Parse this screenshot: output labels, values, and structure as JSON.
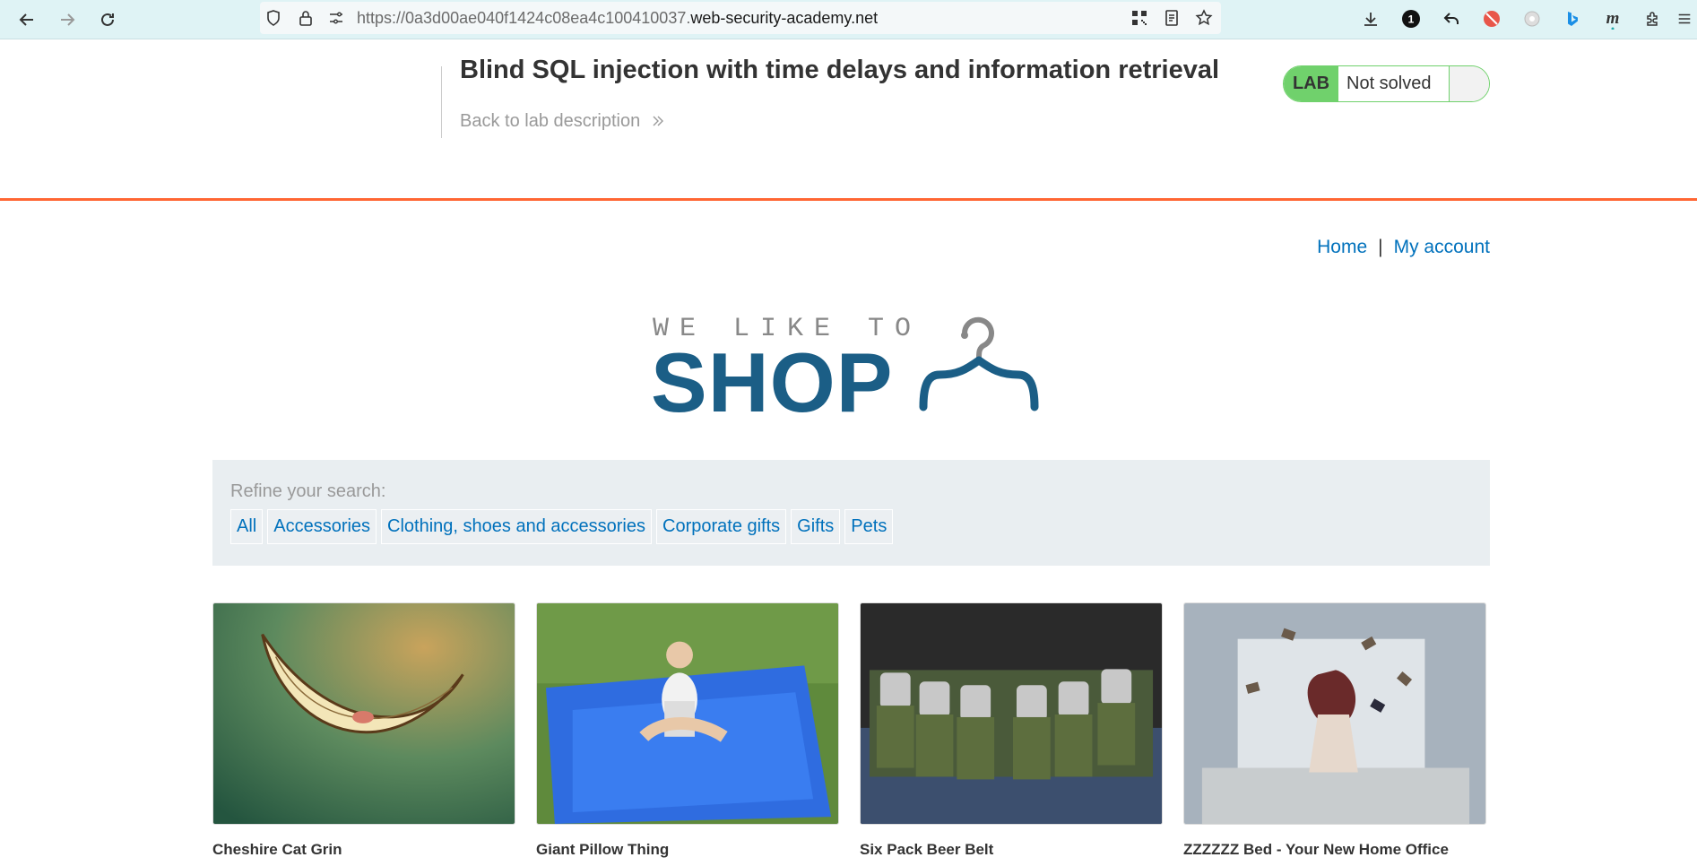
{
  "browser": {
    "url_prefix": "https://0a3d00ae040f1424c08ea4c100410037.",
    "url_domain": "web-security-academy.net",
    "nav": [
      "back-icon",
      "forward-icon",
      "reload-icon"
    ],
    "badge_number": "1"
  },
  "lab": {
    "title": "Blind SQL injection with time delays and information retrieval",
    "back_link": "Back to lab description",
    "status_label": "LAB",
    "status_value": "Not solved",
    "accent_color": "#70d16c",
    "divider_color": "#ff6633"
  },
  "top_nav": {
    "home": "Home",
    "separator": "|",
    "account": "My account"
  },
  "logo": {
    "line1": "WE LIKE TO",
    "line2": "SHOP"
  },
  "filter": {
    "label": "Refine your search:",
    "categories": [
      "All",
      "Accessories",
      "Clothing, shoes and accessories",
      "Corporate gifts",
      "Gifts",
      "Pets"
    ]
  },
  "products": [
    {
      "name": "Cheshire Cat Grin"
    },
    {
      "name": "Giant Pillow Thing"
    },
    {
      "name": "Six Pack Beer Belt"
    },
    {
      "name": "ZZZZZZ Bed - Your New Home Office"
    }
  ],
  "colors": {
    "link": "#0071bc",
    "brand": "#1b5e86"
  }
}
